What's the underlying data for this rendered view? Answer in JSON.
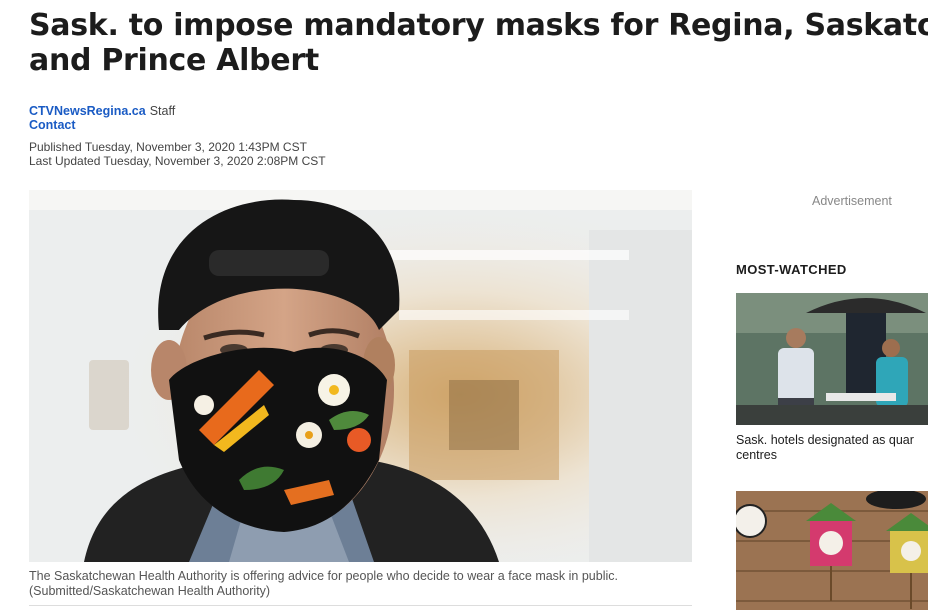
{
  "article": {
    "headline_line1": "Sask. to impose mandatory masks for Regina, Saskatoon",
    "headline_line2": "and Prince Albert",
    "byline_source": "CTVNewsRegina.ca",
    "byline_role": "Staff",
    "contact_label": "Contact",
    "published": "Published Tuesday, November 3, 2020 1:43PM CST",
    "updated": "Last Updated Tuesday, November 3, 2020 2:08PM CST",
    "image_caption_line1": "The Saskatchewan Health Authority is offering advice for people who decide to wear a face mask in public.",
    "image_caption_line2": "(Submitted/Saskatchewan Health Authority)"
  },
  "sidebar": {
    "ad_label": "Advertisement",
    "section_title": "MOST-WATCHED",
    "videos": [
      {
        "title_line1": "Sask. hotels designated as quar",
        "title_line2": "centres"
      }
    ]
  },
  "colors": {
    "link": "#1a5bc4",
    "headline": "#1c1c1c",
    "meta_text": "#444444",
    "caption_text": "#555555"
  }
}
